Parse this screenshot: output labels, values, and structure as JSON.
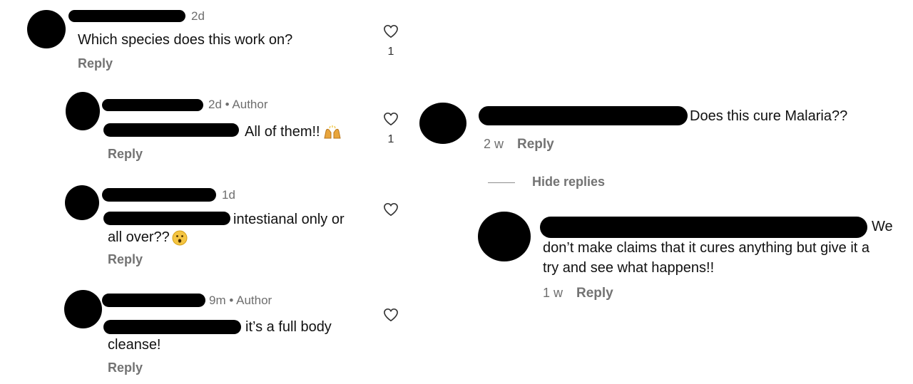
{
  "left_thread": {
    "comments": [
      {
        "time": "2d",
        "author_badge": "",
        "text": "Which species does this work on?",
        "reply_label": "Reply",
        "likes": "1"
      },
      {
        "time": "2d",
        "author_badge": "Author",
        "text": "All of them!!",
        "reply_label": "Reply",
        "likes": "1",
        "emoji": "raised-hands-icon"
      },
      {
        "time": "1d",
        "author_badge": "",
        "text_line1": "intestianal only or",
        "text_line2": "all over??",
        "reply_label": "Reply",
        "emoji": "surprised-face-icon"
      },
      {
        "time": "9m",
        "author_badge": "Author",
        "text_line1": "it’s a full body",
        "text_line2": "cleanse!",
        "reply_label": "Reply"
      }
    ]
  },
  "right_thread": {
    "comment": {
      "text": "Does this cure Malaria??",
      "time": "2 w",
      "reply_label": "Reply"
    },
    "hide_replies_label": "Hide replies",
    "reply": {
      "text_line1": "We",
      "text_line2": "don’t make claims that it cures anything but give it a",
      "text_line3": "try and see what happens!!",
      "time": "1 w",
      "reply_label": "Reply"
    }
  },
  "separator": "•",
  "colors": {
    "redaction": "#000000",
    "meta_gray": "#6e6e6e",
    "reply_gray": "#737373"
  }
}
